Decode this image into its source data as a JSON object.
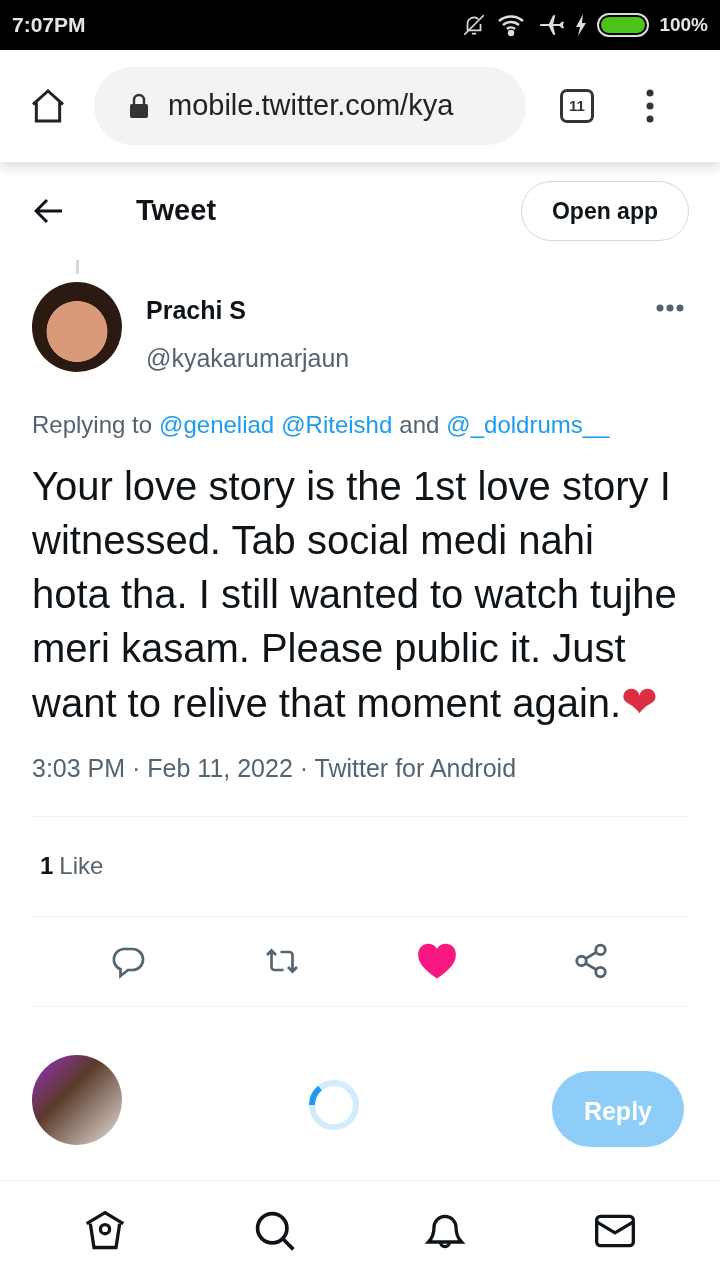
{
  "status_bar": {
    "time": "7:07PM",
    "battery": "100%"
  },
  "browser": {
    "url": "mobile.twitter.com/kya",
    "tab_count": "11"
  },
  "header": {
    "title": "Tweet",
    "open_app": "Open app"
  },
  "tweet": {
    "name": "Prachi S",
    "handle": "@kyakarumarjaun",
    "replying_to": [
      {
        "kind": "text",
        "text": "Replying to"
      },
      {
        "kind": "link",
        "text": "@geneliad"
      },
      {
        "kind": "link",
        "text": "@Riteishd"
      },
      {
        "kind": "text",
        "text": "and"
      },
      {
        "kind": "link",
        "text": "@_doldrums__"
      }
    ],
    "text": "Your love story is the 1st love story I witnessed. Tab social medi nahi hota tha. I still wanted to watch tujhe meri kasam. Please public it. Just want to relive that moment again.",
    "emoji": "❤",
    "meta": "3:03 PM · Feb 11, 2022 · Twitter for Android",
    "like_count": "1",
    "like_label": "Like",
    "liked": true
  },
  "composer": {
    "button": "Reply"
  }
}
